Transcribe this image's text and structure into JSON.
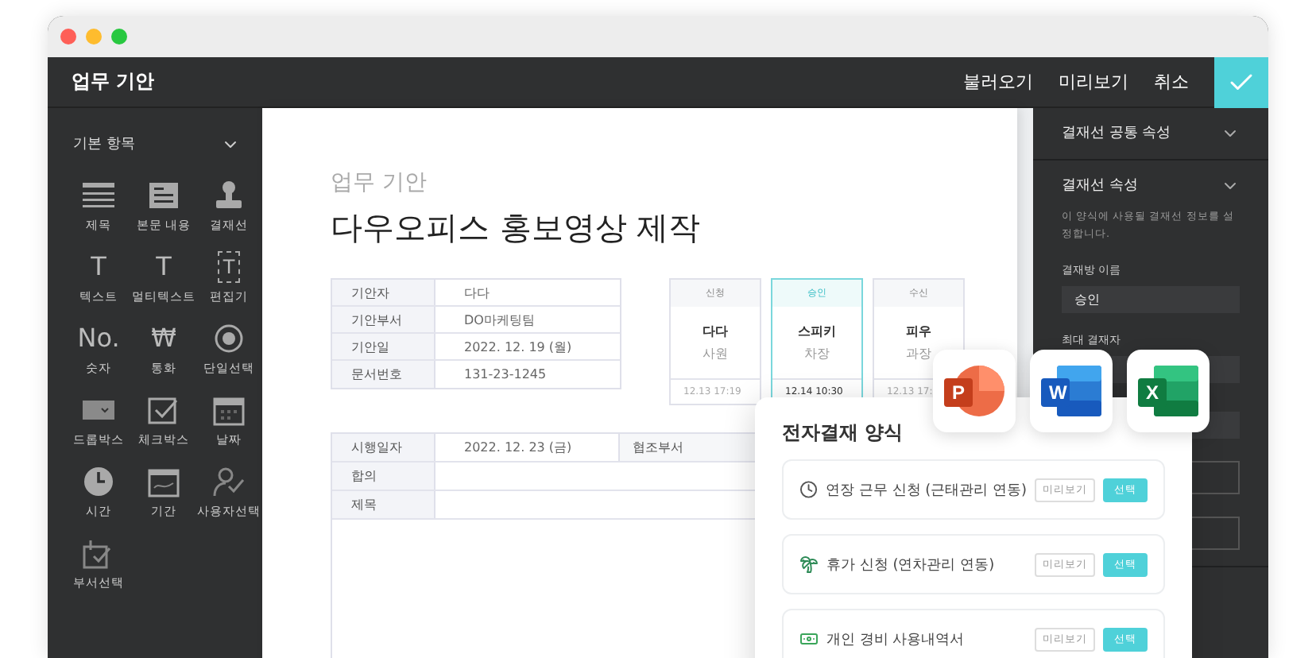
{
  "header": {
    "title": "업무 기안",
    "actions": [
      "불러오기",
      "미리보기",
      "취소"
    ]
  },
  "sidebar": {
    "section": "기본 항목",
    "expanded": true,
    "items": [
      {
        "label": "제목",
        "kind": "title"
      },
      {
        "label": "본문 내용",
        "kind": "body"
      },
      {
        "label": "결재선",
        "kind": "stamp"
      },
      {
        "label": "텍스트",
        "kind": "text",
        "glyph": "T"
      },
      {
        "label": "멀티텍스트",
        "kind": "multitext",
        "glyph": "T"
      },
      {
        "label": "편집기",
        "kind": "editor",
        "glyph": "T"
      },
      {
        "label": "숫자",
        "kind": "number",
        "glyph": "No."
      },
      {
        "label": "통화",
        "kind": "currency",
        "glyph": "₩"
      },
      {
        "label": "단일선택",
        "kind": "radio"
      },
      {
        "label": "드롭박스",
        "kind": "dropdown"
      },
      {
        "label": "체크박스",
        "kind": "checkbox"
      },
      {
        "label": "날짜",
        "kind": "date"
      },
      {
        "label": "시간",
        "kind": "time"
      },
      {
        "label": "기간",
        "kind": "period"
      },
      {
        "label": "사용자선택",
        "kind": "user"
      },
      {
        "label": "부서선택",
        "kind": "dept"
      }
    ]
  },
  "document": {
    "subtitle": "업무 기안",
    "title": "다우오피스 홍보영상 제작",
    "info": [
      {
        "label": "기안자",
        "value": "다다"
      },
      {
        "label": "기안부서",
        "value": "DO마케팅팀"
      },
      {
        "label": "기안일",
        "value": "2022. 12. 19 (월)"
      },
      {
        "label": "문서번호",
        "value": "131-23-1245"
      }
    ],
    "approvals": [
      {
        "step": "신청",
        "name": "다다",
        "position": "사원",
        "time": "12.13 17:19",
        "selected": false
      },
      {
        "step": "승인",
        "name": "스피키",
        "position": "차장",
        "time": "12.14 10:30",
        "selected": true
      },
      {
        "step": "수신",
        "name": "피우",
        "position": "과장",
        "time": "12.13 17:",
        "selected": false
      }
    ],
    "details": [
      {
        "label": "시행일자",
        "value": "2022. 12. 23 (금)",
        "extra_label": "협조부서"
      },
      {
        "label": "합의"
      },
      {
        "label": "제목"
      }
    ]
  },
  "properties": {
    "sections": [
      {
        "title": "결재선 공통 속성"
      },
      {
        "title": "결재선 속성",
        "description": "이 양식에 사용될 결재선 정보를 설정합니다.",
        "fields": [
          {
            "label": "결재방 이름",
            "value": "승인"
          },
          {
            "label": "최대 결재자"
          }
        ]
      }
    ]
  },
  "apps": [
    {
      "kind": "presentation",
      "letter": "P"
    },
    {
      "kind": "word",
      "letter": "W"
    },
    {
      "kind": "sheet",
      "letter": "X"
    }
  ],
  "forms": {
    "title": "전자결재 양식",
    "items": [
      {
        "kind": "clock",
        "label": "연장 근무 신청 (근태관리 연동)",
        "preview": "미리보기",
        "select": "선택"
      },
      {
        "kind": "palm",
        "label": "휴가 신청 (연차관리 연동)",
        "preview": "미리보기",
        "select": "선택"
      },
      {
        "kind": "money",
        "label": "개인 경비 사용내역서",
        "preview": "미리보기",
        "select": "선택"
      }
    ]
  }
}
